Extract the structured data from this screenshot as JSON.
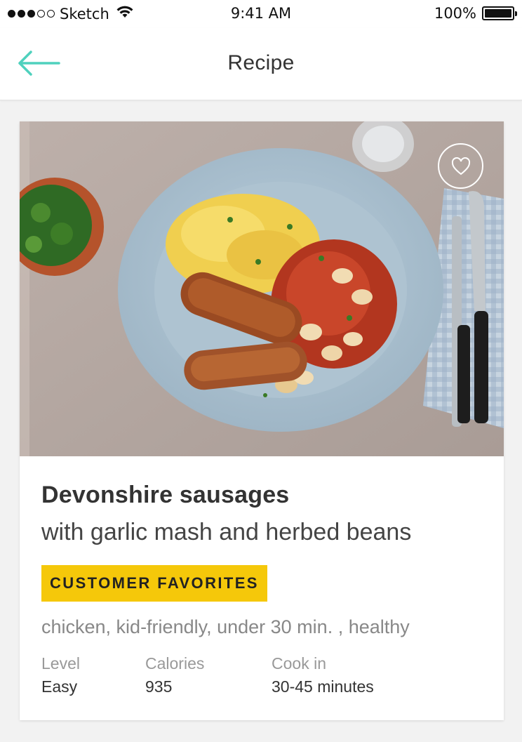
{
  "status_bar": {
    "carrier": "Sketch",
    "time": "9:41 AM",
    "battery": "100%",
    "signal_bars_filled": 3,
    "signal_bars_total": 5
  },
  "nav": {
    "title": "Recipe",
    "back_icon": "arrow-left-icon",
    "accent_color": "#4fd1bd"
  },
  "recipe": {
    "title": "Devonshire sausages",
    "subtitle": "with garlic mash and herbed beans",
    "badge": "CUSTOMER FAVORITES",
    "badge_color": "#f5c80a",
    "tags": "chicken, kid-friendly, under 30 min. , healthy",
    "favorite_icon": "heart-outline-icon",
    "stats": [
      {
        "label": "Level",
        "value": "Easy"
      },
      {
        "label": "Calories",
        "value": "935"
      },
      {
        "label": "Cook in",
        "value": "30-45 minutes"
      }
    ]
  }
}
